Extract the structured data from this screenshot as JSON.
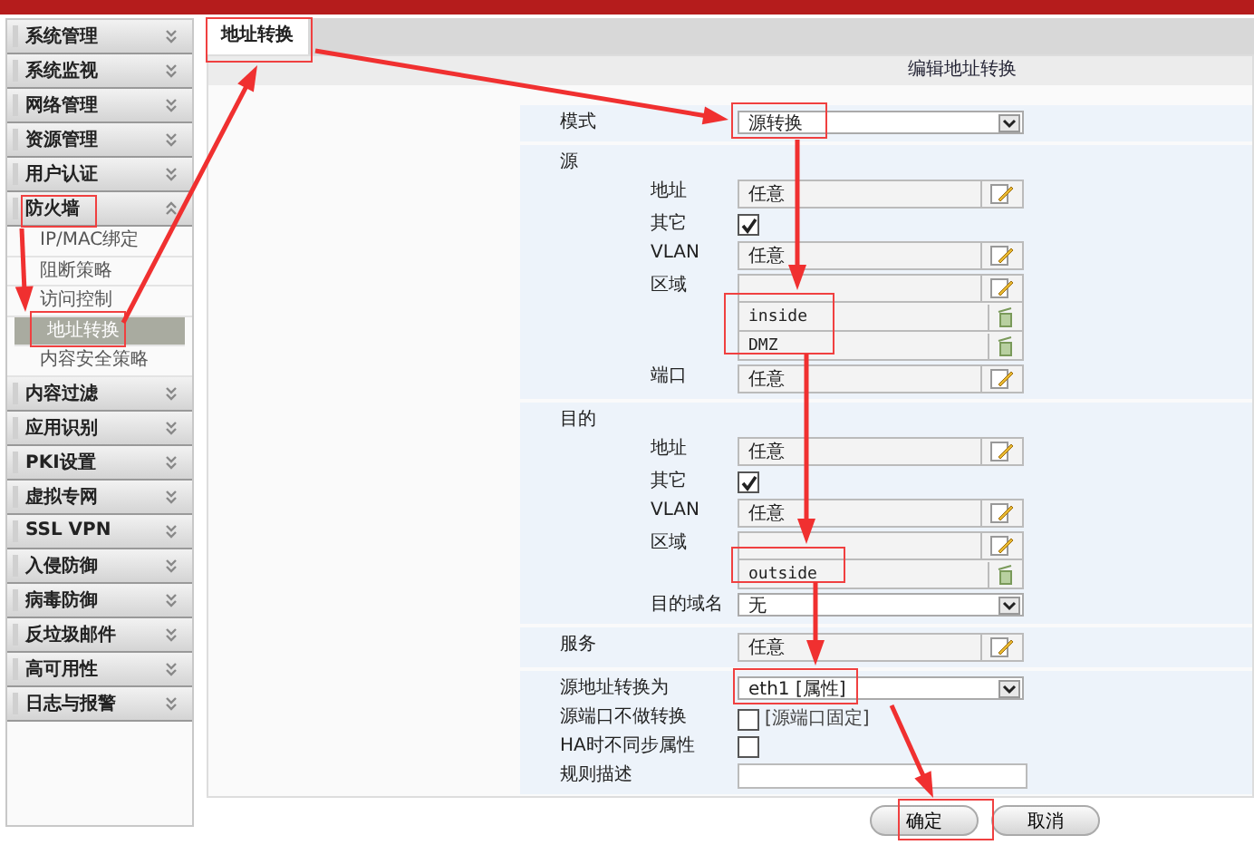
{
  "sidebar": {
    "items": [
      {
        "label": "系统管理",
        "expanded": false
      },
      {
        "label": "系统监视",
        "expanded": false
      },
      {
        "label": "网络管理",
        "expanded": false
      },
      {
        "label": "资源管理",
        "expanded": false
      },
      {
        "label": "用户认证",
        "expanded": false
      },
      {
        "label": "防火墙",
        "expanded": true,
        "children": [
          {
            "label": "IP/MAC绑定",
            "selected": false
          },
          {
            "label": "阻断策略",
            "selected": false
          },
          {
            "label": "访问控制",
            "selected": false
          },
          {
            "label": "地址转换",
            "selected": true
          },
          {
            "label": "内容安全策略",
            "selected": false
          }
        ]
      },
      {
        "label": "内容过滤",
        "expanded": false
      },
      {
        "label": "应用识别",
        "expanded": false
      },
      {
        "label": "PKI设置",
        "expanded": false
      },
      {
        "label": "虚拟专网",
        "expanded": false
      },
      {
        "label": "SSL VPN",
        "expanded": false
      },
      {
        "label": "入侵防御",
        "expanded": false
      },
      {
        "label": "病毒防御",
        "expanded": false
      },
      {
        "label": "反垃圾邮件",
        "expanded": false
      },
      {
        "label": "高可用性",
        "expanded": false
      },
      {
        "label": "日志与报警",
        "expanded": false
      }
    ]
  },
  "tabs": [
    {
      "label": "地址转换",
      "selected": true
    }
  ],
  "panel": {
    "title": "编辑地址转换",
    "sections": [
      {
        "rows": [
          {
            "kind": "select",
            "label": "模式",
            "value": "源转换"
          }
        ]
      },
      {
        "title": "源",
        "rows": [
          {
            "kind": "field",
            "label": "地址",
            "value": "任意"
          },
          {
            "kind": "check",
            "label": "其它",
            "checked": true
          },
          {
            "kind": "field",
            "label": "VLAN",
            "value": "任意"
          },
          {
            "kind": "zone",
            "label": "区域",
            "entries": [
              "inside",
              "DMZ"
            ]
          },
          {
            "kind": "field",
            "label": "端口",
            "value": "任意"
          }
        ]
      },
      {
        "title": "目的",
        "rows": [
          {
            "kind": "field",
            "label": "地址",
            "value": "任意"
          },
          {
            "kind": "check",
            "label": "其它",
            "checked": true
          },
          {
            "kind": "field",
            "label": "VLAN",
            "value": "任意"
          },
          {
            "kind": "zone",
            "label": "区域",
            "entries": [
              "outside"
            ]
          },
          {
            "kind": "select",
            "label": "目的域名",
            "value": "无"
          }
        ]
      },
      {
        "rows": [
          {
            "kind": "field",
            "label": "服务",
            "value": "任意"
          }
        ]
      },
      {
        "rows": [
          {
            "kind": "select",
            "label": "源地址转换为",
            "value": "eth1 [属性]"
          },
          {
            "kind": "check",
            "label": "源端口不做转换",
            "checked": false,
            "note": "[源端口固定]"
          },
          {
            "kind": "check",
            "label": "HA时不同步属性",
            "checked": false
          },
          {
            "kind": "text",
            "label": "规则描述"
          }
        ]
      }
    ]
  },
  "buttons": [
    "确定",
    "取消"
  ]
}
